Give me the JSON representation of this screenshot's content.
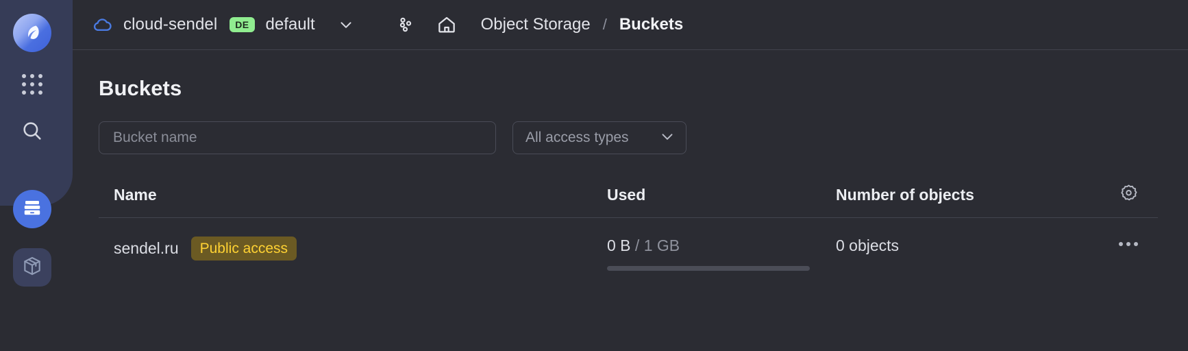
{
  "sidebar": {
    "logo": {
      "name": "brand-logo"
    },
    "items": [
      {
        "name": "grid-icon",
        "label": "Services grid"
      },
      {
        "name": "search-icon",
        "label": "Search"
      },
      {
        "name": "storage-icon",
        "label": "Object Storage",
        "active": true
      },
      {
        "name": "package-icon",
        "label": "Package"
      }
    ]
  },
  "topbar": {
    "cloud_icon": "cloud-icon",
    "org_name": "cloud-sendel",
    "folder_badge": "DE",
    "folder_name": "default",
    "chevron_icon": "chevron-down-icon",
    "nodes_icon": "nodes-icon",
    "home_icon": "home-icon",
    "breadcrumb": [
      {
        "label": "Object Storage",
        "current": false
      },
      {
        "label": "Buckets",
        "current": true
      }
    ],
    "breadcrumb_separator": "/"
  },
  "page": {
    "title": "Buckets"
  },
  "filters": {
    "bucket_name": {
      "value": "",
      "placeholder": "Bucket name"
    },
    "access_type": {
      "selected": "All access types",
      "chevron_icon": "chevron-down-icon"
    }
  },
  "table": {
    "columns": [
      {
        "key": "name",
        "label": "Name"
      },
      {
        "key": "used",
        "label": "Used"
      },
      {
        "key": "objects",
        "label": "Number of objects"
      }
    ],
    "settings_icon": "gear-icon",
    "rows": [
      {
        "name": "sendel.ru",
        "badge": "Public access",
        "used_value": "0 B",
        "used_separator": "/",
        "used_quota": "1 GB",
        "used_percent": 0,
        "objects": "0 objects",
        "menu_icon": "kebab-menu-icon"
      }
    ]
  },
  "colors": {
    "accent": "#4a72e0",
    "badge_public_text": "#ffd233",
    "badge_public_bg": "#6b5a23",
    "folder_badge_bg": "#90ed90",
    "background": "#2b2c33",
    "sidebar_top": "#363c57"
  }
}
